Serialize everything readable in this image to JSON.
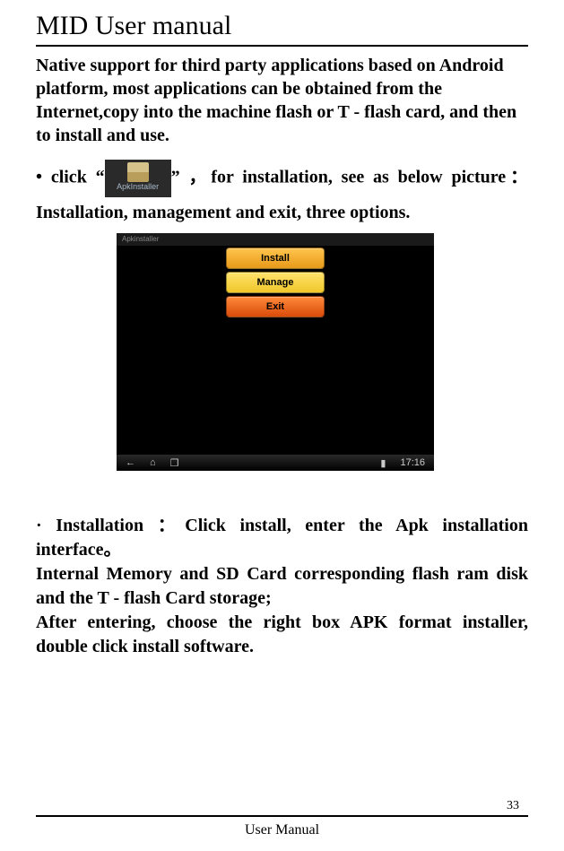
{
  "title": "MID User manual",
  "intro": "Native support for third party applications based on Android platform, most applications can be obtained from the Internet,copy into the machine flash or T - flash card, and then to install and use.",
  "click_prefix": "• click  “",
  "click_suffix": "” ，for installation, see as below picture：Installation, management and exit, three options.",
  "apk_icon_label": "ApkInstaller",
  "screenshot": {
    "topbar_text": "Apkinstaller",
    "buttons": {
      "install": "Install",
      "manage": "Manage",
      "exit": "Exit"
    },
    "time": "17:16",
    "nav": {
      "back": "←",
      "home": "⌂",
      "recent": "❐",
      "battery": "▮"
    }
  },
  "installation_heading_bullet": "·",
  "installation_line1": "Installation ：Click install, enter the Apk installation interface。",
  "installation_line2": "Internal Memory and SD Card corresponding flash ram disk and the T - flash Card storage;",
  "installation_line3": "After entering, choose the right box APK format installer, double click install software.",
  "page_number": "33",
  "footer": "User Manual"
}
